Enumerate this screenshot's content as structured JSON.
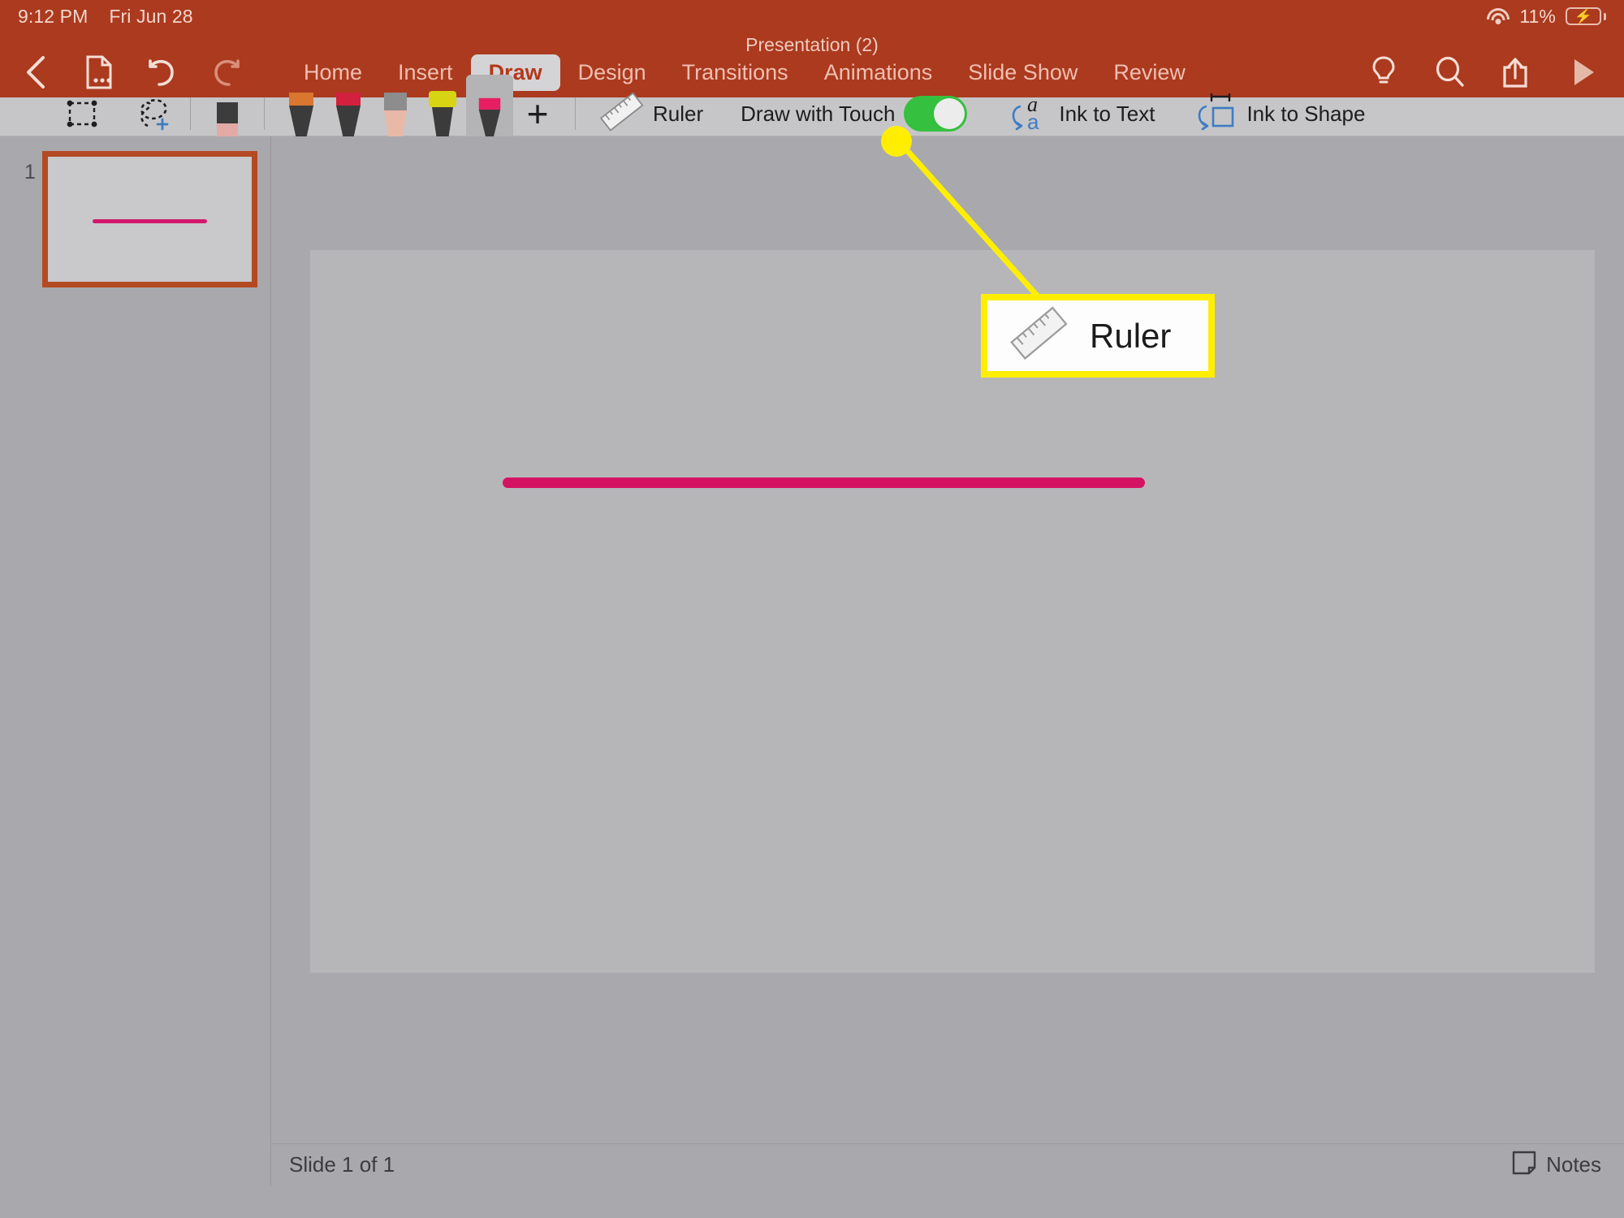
{
  "statusbar": {
    "time": "9:12 PM",
    "date": "Fri Jun 28",
    "battery_percent": "11%",
    "wifi_icon": "wifi-icon",
    "battery_icon": "battery-charging-icon"
  },
  "ribbon": {
    "document_title": "Presentation (2)",
    "quick_actions": [
      {
        "name": "back-button",
        "icon": "chevron-left-icon"
      },
      {
        "name": "file-menu-button",
        "icon": "file-options-icon"
      },
      {
        "name": "undo-button",
        "icon": "undo-arrow-icon"
      },
      {
        "name": "redo-button",
        "icon": "redo-arrow-icon"
      }
    ],
    "tabs": [
      {
        "label": "Home",
        "active": false
      },
      {
        "label": "Insert",
        "active": false
      },
      {
        "label": "Draw",
        "active": true
      },
      {
        "label": "Design",
        "active": false
      },
      {
        "label": "Transitions",
        "active": false
      },
      {
        "label": "Animations",
        "active": false
      },
      {
        "label": "Slide Show",
        "active": false
      },
      {
        "label": "Review",
        "active": false
      }
    ],
    "right_actions": [
      {
        "name": "tell-me-button",
        "icon": "lightbulb-icon"
      },
      {
        "name": "search-button",
        "icon": "search-icon"
      },
      {
        "name": "share-button",
        "icon": "share-icon"
      },
      {
        "name": "play-slideshow-button",
        "icon": "play-icon"
      }
    ],
    "accent_color": "#ab3a1e",
    "active_tab_bg": "#d4d4d6",
    "active_tab_text": "#b5371b"
  },
  "drawbar": {
    "select_tool": {
      "name": "select-objects-tool",
      "icon": "dashed-rectangle-icon"
    },
    "lasso_tool": {
      "name": "lasso-select-tool",
      "icon": "lasso-plus-icon"
    },
    "eraser_tool": {
      "name": "eraser-tool",
      "icon": "eraser-icon"
    },
    "pens": [
      {
        "name": "pen-orange",
        "icon": "pen-icon",
        "color": "#d9621f",
        "body": "#3b3b3b",
        "cap": "#d9762f",
        "type": "pen",
        "selected": false
      },
      {
        "name": "pen-red",
        "icon": "pen-icon",
        "color": "#d81f28",
        "body": "#3b3b3b",
        "cap": "#d3203e",
        "type": "pen",
        "selected": false
      },
      {
        "name": "pencil-gray",
        "icon": "pencil-icon",
        "color": "#5a5a5a",
        "body": "#e8b9a6",
        "cap": "#8d8d8d",
        "type": "pencil",
        "selected": false
      },
      {
        "name": "highlighter-yellow",
        "icon": "highlighter-icon",
        "color": "#d7d414",
        "body": "#3b3b3b",
        "cap": "#d7d414",
        "type": "highlighter",
        "selected": false
      },
      {
        "name": "pen-pink",
        "icon": "pen-icon",
        "color": "#e81e63",
        "body": "#3b3b3b",
        "cap": "#e81e63",
        "type": "pen",
        "selected": true
      }
    ],
    "add_pen_button": {
      "label": "+",
      "name": "add-pen-button"
    },
    "ruler": {
      "label": "Ruler",
      "icon": "ruler-icon"
    },
    "draw_with_touch": {
      "label": "Draw with Touch",
      "enabled": true,
      "toggle_color": "#35c03f"
    },
    "ink_to_text": {
      "label": "Ink to Text",
      "icon": "ink-to-text-icon"
    },
    "ink_to_shape": {
      "label": "Ink to Shape",
      "icon": "ink-to-shape-icon"
    }
  },
  "sidebar": {
    "slides": [
      {
        "number": "1",
        "selected": true,
        "stroke_color": "#d2186b"
      }
    ]
  },
  "canvas": {
    "slide_bg": "#b6b6b9",
    "ink_stroke_color": "#d41463"
  },
  "callout": {
    "label": "Ruler",
    "icon": "ruler-icon",
    "border_color": "#ffee00",
    "marker_color": "#ffee00"
  },
  "bottombar": {
    "slide_counter": "Slide 1 of 1",
    "notes": {
      "label": "Notes",
      "icon": "notes-page-icon"
    }
  }
}
